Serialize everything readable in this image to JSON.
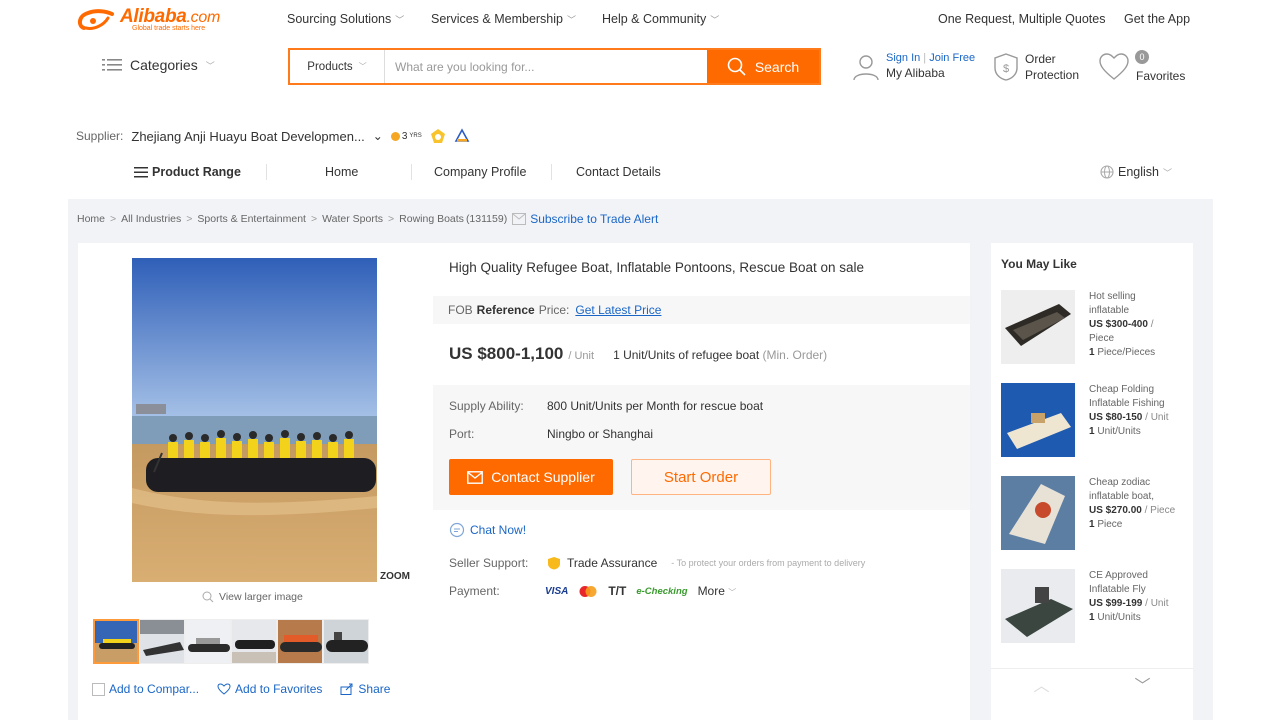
{
  "header": {
    "logo_main": "Alibaba",
    "logo_com": ".com",
    "logo_tagline": "Global trade starts here",
    "nav": [
      "Sourcing Solutions",
      "Services & Membership",
      "Help & Community"
    ],
    "rfq_link": "One Request, Multiple Quotes",
    "app_link": "Get the App",
    "categories_label": "Categories",
    "search": {
      "category": "Products",
      "placeholder": "What are you looking for...",
      "button": "Search"
    },
    "sign_in": "Sign In",
    "join_free": "Join Free",
    "my_alibaba": "My Alibaba",
    "order_protection_1": "Order",
    "order_protection_2": "Protection",
    "favorites_count": "0",
    "favorites_label": "Favorites"
  },
  "supplier": {
    "label": "Supplier:",
    "name": "Zhejiang Anji Huayu Boat Developmen...",
    "gold_years": "3",
    "gold_suffix": "YRS"
  },
  "company_nav": {
    "product_range": "Product Range",
    "home": "Home",
    "company_profile": "Company Profile",
    "contact_details": "Contact Details",
    "language": "English"
  },
  "breadcrumb": {
    "items": [
      "Home",
      "All Industries",
      "Sports & Entertainment",
      "Water Sports"
    ],
    "last": "Rowing Boats",
    "count": "(131159)",
    "subscribe": "Subscribe to Trade Alert"
  },
  "gallery": {
    "zoom": "ZOOM",
    "view_larger": "View larger image",
    "add_compare": "Add to Compar...",
    "add_favorites": "Add to Favorites",
    "share": "Share"
  },
  "product": {
    "title": "High Quality Refugee Boat, Inflatable Pontoons, Rescue Boat on sale",
    "fob_prefix": "FOB",
    "fob_bold": "Reference",
    "fob_suffix": "Price:",
    "fob_link": "Get Latest Price",
    "price": "US $800-1,100",
    "price_unit": "/ Unit",
    "moq": "1 Unit/Units of refugee boat",
    "moq_note": "(Min. Order)",
    "supply_label": "Supply Ability:",
    "supply_value": "800 Unit/Units per Month for rescue boat",
    "port_label": "Port:",
    "port_value": "Ningbo or Shanghai",
    "contact_btn": "Contact Supplier",
    "order_btn": "Start Order",
    "chat": "Chat Now!",
    "seller_label": "Seller Support:",
    "trade_assurance": "Trade Assurance",
    "ta_note": "- To protect your orders from payment to delivery",
    "payment_label": "Payment:",
    "pay_visa": "VISA",
    "pay_tt": "T/T",
    "pay_echeck": "e-Checking",
    "pay_more": "More"
  },
  "you_may_like": {
    "title": "You May Like",
    "items": [
      {
        "l1": "Hot selling",
        "l2": "inflatable",
        "price": "US $300-400",
        "per": "/",
        "l4": "Piece",
        "qty": "1",
        "unit": "Piece/Pieces"
      },
      {
        "l1": "Cheap Folding",
        "l2": "Inflatable Fishing",
        "price": "US $80-150",
        "per": "/ Unit",
        "l4": "",
        "qty": "1",
        "unit": "Unit/Units"
      },
      {
        "l1": "Cheap zodiac",
        "l2": "inflatable boat,",
        "price": "US $270.00",
        "per": "/ Piece",
        "l4": "",
        "qty": "1",
        "unit": "Piece"
      },
      {
        "l1": "CE Approved",
        "l2": "Inflatable Fly",
        "price": "US $99-199",
        "per": "/ Unit",
        "l4": "",
        "qty": "1",
        "unit": "Unit/Units"
      }
    ]
  },
  "colors": {
    "accent": "#ff6a00",
    "link": "#1a66c7",
    "panel_bg": "#f2f3f7"
  }
}
